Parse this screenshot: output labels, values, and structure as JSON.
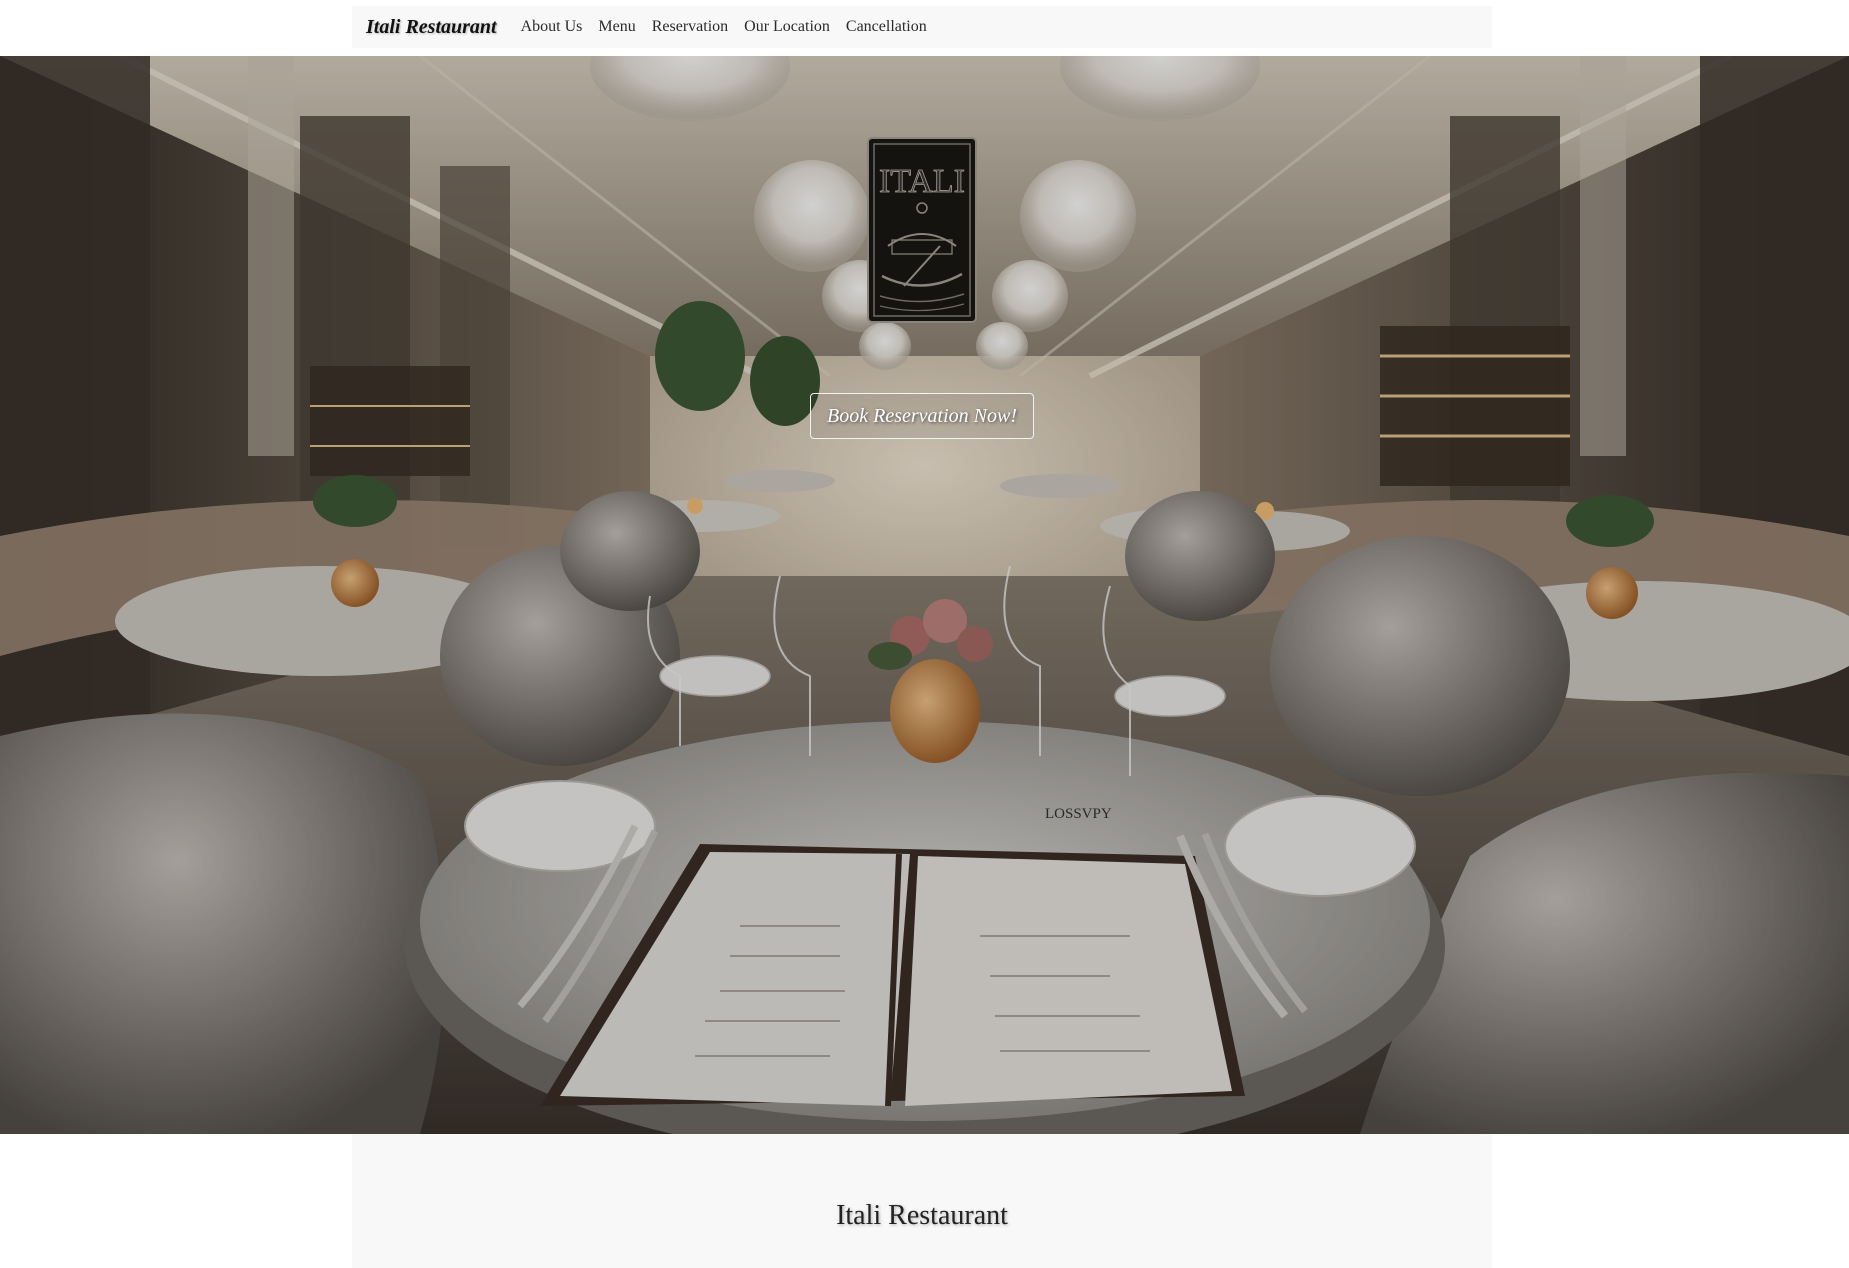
{
  "navbar": {
    "brand": "Itali Restaurant",
    "links": [
      "About Us",
      "Menu",
      "Reservation",
      "Our Location",
      "Cancellation"
    ]
  },
  "hero": {
    "logo_text": "ITALI",
    "cta_label": "Book Reservation Now!"
  },
  "section": {
    "title": "Itali Restaurant"
  },
  "icons": {
    "logo": "gondola-logo-icon"
  },
  "colors": {
    "navbar_bg": "#f8f8f8",
    "cta_border": "#f2f2f2",
    "text_dark": "#222222"
  }
}
